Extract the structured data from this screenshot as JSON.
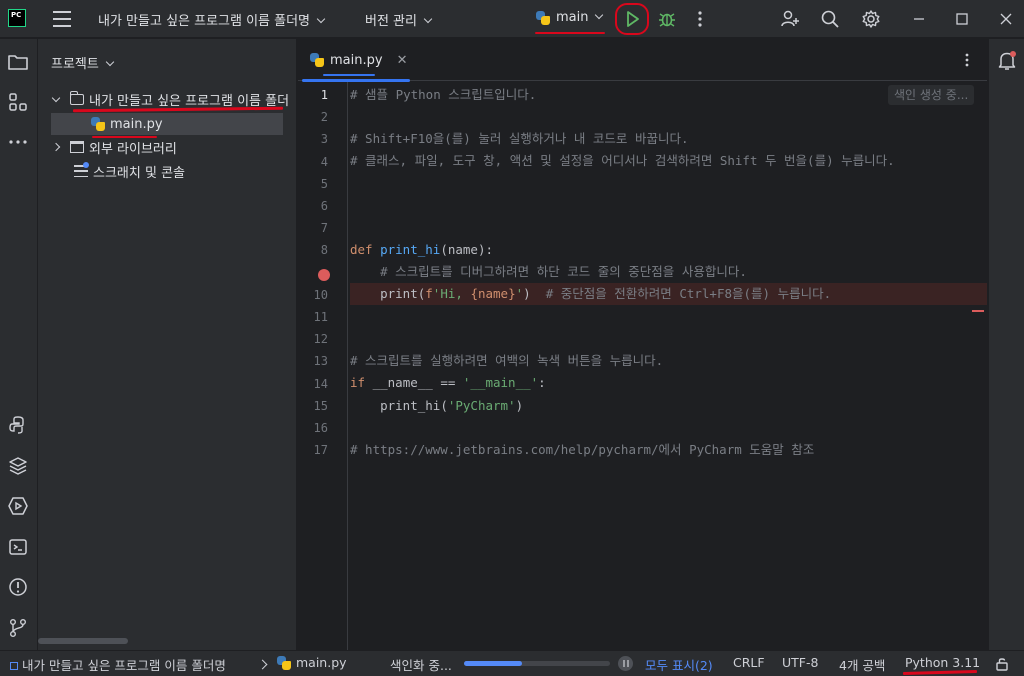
{
  "titlebar": {
    "project_name": "내가 만들고 싶은 프로그램 이름 폴더명",
    "vcs_label": "버전 관리",
    "run_config": "main"
  },
  "project_panel": {
    "title": "프로젝트",
    "root_folder": "내가 만들고 싶은 프로그램 이름 폴더",
    "file": "main.py",
    "external_libs": "외부 라이브러리",
    "scratches": "스크래치 및 콘솔"
  },
  "editor": {
    "tab_label": "main.py",
    "indexing_hint": "색인 생성 중...",
    "line_numbers": [
      "1",
      "2",
      "3",
      "4",
      "5",
      "6",
      "7",
      "8",
      "9",
      "10",
      "11",
      "12",
      "13",
      "14",
      "15",
      "16",
      "17"
    ],
    "active_line": 1,
    "breakpoint_line": 9,
    "lines": {
      "l1": "# 샘플 Python 스크립트입니다.",
      "l3": "# Shift+F10을(를) 눌러 실행하거나 내 코드로 바꿉니다.",
      "l4": "# 클래스, 파일, 도구 창, 액션 및 설정을 어디서나 검색하려면 Shift 두 번을(를) 누릅니다.",
      "l7_kw": "def",
      "l7_fn": "print_hi",
      "l7_rest": "(name):",
      "l8": "# 스크립트를 디버그하려면 하단 코드 줄의 중단점을 사용합니다.",
      "l9_call": "print(",
      "l9_prefix": "f",
      "l9_str1": "'Hi, ",
      "l9_expr": "{name}",
      "l9_str2": "'",
      "l9_close": ")",
      "l9_comment": "# 중단점을 전환하려면 Ctrl+F8을(를) 누릅니다.",
      "l12": "# 스크립트를 실행하려면 여백의 녹색 버튼을 누릅니다.",
      "l13_kw": "if",
      "l13_mid": " __name__ == ",
      "l13_str": "'__main__'",
      "l13_end": ":",
      "l14_call": "print_hi(",
      "l14_str": "'PyCharm'",
      "l14_end": ")",
      "l16": "# https://www.jetbrains.com/help/pycharm/에서 PyCharm 도움말 참조"
    }
  },
  "statusbar": {
    "breadcrumb_project": "내가 만들고 싶은 프로그램 이름 폴더명",
    "breadcrumb_file": "main.py",
    "indexing": "색인화 중...",
    "indexing_progress": 0.4,
    "show_all": "모두 표시(2)",
    "line_ending": "CRLF",
    "encoding": "UTF-8",
    "indent": "4개 공백",
    "interpreter": "Python 3.11"
  },
  "colors": {
    "annotation_red": "#d9071c",
    "annotation_blue": "#3574f0",
    "run_green": "#5fb865",
    "breakpoint_red": "#db5c5c"
  },
  "icons": [
    "menu-icon",
    "run-icon",
    "debug-bug-icon",
    "more-vertical-icon",
    "add-user-icon",
    "search-icon",
    "gear-icon",
    "minimize-icon",
    "maximize-icon",
    "close-icon",
    "folder-icon",
    "structure-icon",
    "python-console-icon",
    "layers-icon",
    "services-icon",
    "terminal-icon",
    "problems-icon",
    "git-icon",
    "notification-bell-icon",
    "lock-icon"
  ]
}
